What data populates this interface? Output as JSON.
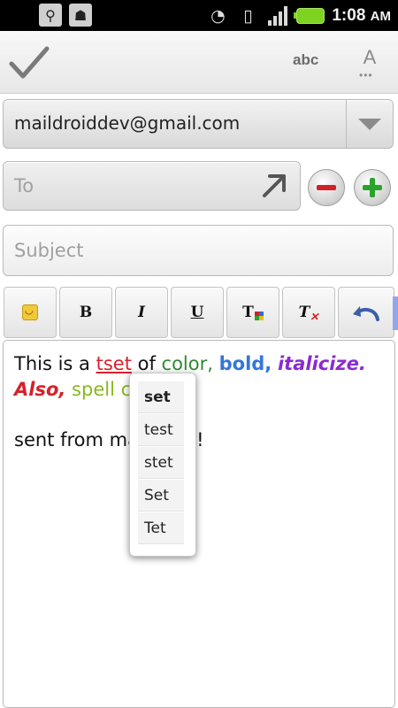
{
  "status_bar": {
    "icons_left": [
      "usb-icon",
      "android-debug-icon"
    ],
    "icons_right": [
      "wifi-icon",
      "vibrate-icon",
      "signal-icon",
      "battery-icon"
    ],
    "time": "1:08",
    "ampm": "AM"
  },
  "toolbar": {
    "confirm_icon": "check-icon",
    "spellcheck_label": "abc",
    "font_label": "A"
  },
  "compose": {
    "account": "maildroiddev@gmail.com",
    "to_placeholder": "To",
    "subject_placeholder": "Subject"
  },
  "format_toolbar": {
    "buttons": [
      {
        "name": "emoji",
        "icon": "smiley-icon"
      },
      {
        "name": "bold",
        "label": "B"
      },
      {
        "name": "italic",
        "label": "I"
      },
      {
        "name": "underline",
        "label": "U"
      },
      {
        "name": "text-color",
        "label": "T"
      },
      {
        "name": "clear-format",
        "label": "T"
      },
      {
        "name": "undo",
        "icon": "undo-icon"
      }
    ]
  },
  "body": {
    "line1_a": "This is a ",
    "misspelled": "tset",
    "line1_b": " of ",
    "color_word": "color,",
    "line1_c": " ",
    "bold_word": "bold,",
    "line1_d": " ",
    "italic_word": "italicize.",
    "also_word": "Also,",
    "line2_a": " ",
    "spell_word": "spell c",
    "signature": "sent from maildroid!"
  },
  "spell_suggestions": [
    "set",
    "test",
    "stet",
    "Set",
    "Tet"
  ]
}
